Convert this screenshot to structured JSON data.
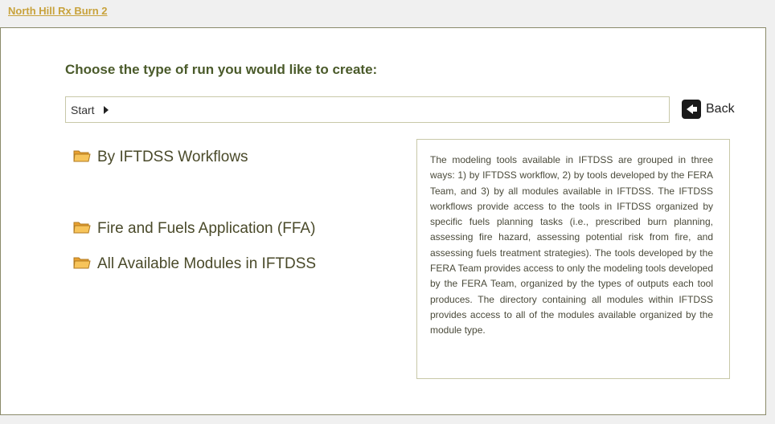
{
  "header": {
    "project_link": "North Hill Rx Burn 2"
  },
  "main": {
    "heading": "Choose the type of run you would like to create:",
    "breadcrumb": {
      "start_label": "Start"
    },
    "back_label": "Back",
    "options": [
      {
        "label": "By IFTDSS Workflows",
        "icon": "folder-icon"
      },
      {
        "label": "Fire and Fuels Application (FFA)",
        "icon": "folder-icon"
      },
      {
        "label": "All Available Modules in IFTDSS",
        "icon": "folder-icon"
      }
    ],
    "info_text": "The modeling tools available in IFTDSS are grouped in three ways: 1) by IFTDSS workflow, 2) by tools developed by the FERA Team, and 3) by all modules available in IFTDSS. The IFTDSS workflows provide access to the tools in IFTDSS organized by specific fuels planning tasks (i.e., prescribed burn planning, assessing fire hazard, assessing potential risk from fire, and assessing fuels treatment strategies). The tools developed by the FERA Team provides access to only the modeling tools developed by the FERA Team, organized by the types of outputs each tool produces. The directory containing all modules within IFTDSS provides access to all of the modules available organized by the module type."
  },
  "colors": {
    "link": "#c8a23c",
    "heading": "#4a5a2a",
    "border": "#8a8a6a",
    "folder_fill": "#f5b94a"
  }
}
